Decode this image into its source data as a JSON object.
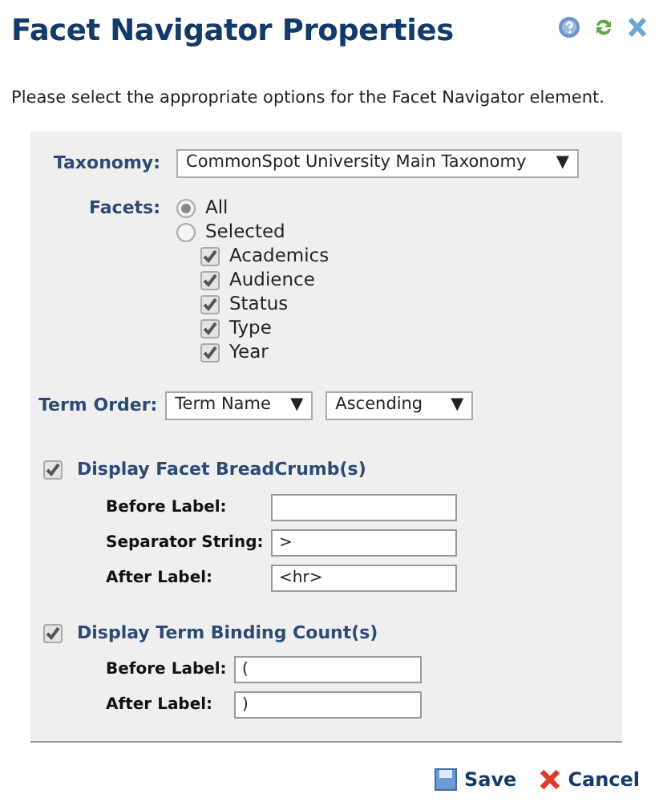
{
  "title": "Facet Navigator Properties",
  "description": "Please select the appropriate options for the Facet Navigator element.",
  "taxonomy": {
    "label": "Taxonomy:",
    "value": "CommonSpot University Main Taxonomy",
    "caret": "▼"
  },
  "facets": {
    "label": "Facets:",
    "options": [
      {
        "label": "All",
        "selected": true
      },
      {
        "label": "Selected",
        "selected": false
      }
    ],
    "items": [
      {
        "label": "Academics",
        "checked": true
      },
      {
        "label": "Audience",
        "checked": true
      },
      {
        "label": "Status",
        "checked": true
      },
      {
        "label": "Type",
        "checked": true
      },
      {
        "label": "Year",
        "checked": true
      }
    ]
  },
  "term_order": {
    "label": "Term Order:",
    "selects": [
      {
        "value": "Term Name",
        "caret": "▼"
      },
      {
        "value": "Ascending",
        "caret": "▼"
      }
    ]
  },
  "sections": [
    {
      "label": "Display Facet BreadCrumb(s)",
      "checked": true,
      "fields": [
        {
          "label": "Before Label:"
        },
        {
          "label": "Separator String:",
          "value": ">"
        },
        {
          "label": "After Label:",
          "value": "<hr>"
        }
      ]
    },
    {
      "label": "Display Term Binding Count(s)",
      "checked": true,
      "fields": [
        {
          "label": "Before Label:",
          "value": "("
        },
        {
          "label": "After Label:",
          "value": ")"
        }
      ]
    }
  ],
  "buttons": [
    {
      "label": "Save",
      "kind": "save"
    },
    {
      "label": "Cancel",
      "kind": "cancel"
    }
  ]
}
